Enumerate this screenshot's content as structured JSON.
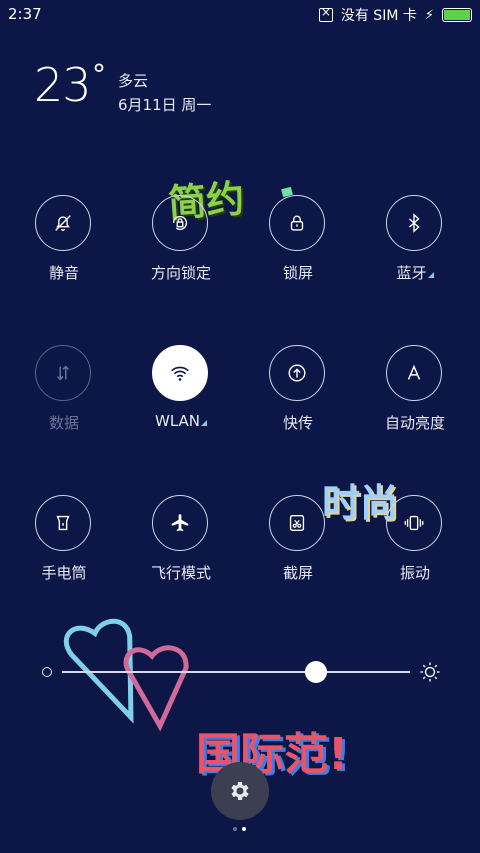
{
  "status_bar": {
    "time": "2:37",
    "sim_status": "没有 SIM 卡",
    "battery_color": "#5ad447"
  },
  "weather": {
    "temperature": "23",
    "degree_symbol": "°",
    "condition": "多云",
    "date": "6月11日 周一"
  },
  "toggles": [
    {
      "label": "静音",
      "icon": "bell-off-icon",
      "state": "off"
    },
    {
      "label": "方向锁定",
      "icon": "rotation-lock-icon",
      "state": "off"
    },
    {
      "label": "锁屏",
      "icon": "lock-icon",
      "state": "off"
    },
    {
      "label": "蓝牙",
      "icon": "bluetooth-icon",
      "state": "off",
      "has_more": true
    },
    {
      "label": "数据",
      "icon": "mobile-data-icon",
      "state": "disabled"
    },
    {
      "label": "WLAN",
      "icon": "wifi-icon",
      "state": "on",
      "has_more": true
    },
    {
      "label": "快传",
      "icon": "quick-transfer-icon",
      "state": "off"
    },
    {
      "label": "自动亮度",
      "icon": "auto-brightness-icon",
      "state": "off"
    },
    {
      "label": "手电筒",
      "icon": "flashlight-icon",
      "state": "off"
    },
    {
      "label": "飞行模式",
      "icon": "airplane-icon",
      "state": "off"
    },
    {
      "label": "截屏",
      "icon": "screenshot-icon",
      "state": "off"
    },
    {
      "label": "振动",
      "icon": "vibrate-icon",
      "state": "off"
    }
  ],
  "brightness": {
    "level": 0.73
  },
  "wallpaper_text": {
    "top": "简约",
    "middle": "时尚",
    "bottom": "国际范!"
  },
  "pager": {
    "pages": 2,
    "current": 2
  },
  "colors": {
    "background": "#0c1747",
    "accent": "#8fc7e0"
  }
}
